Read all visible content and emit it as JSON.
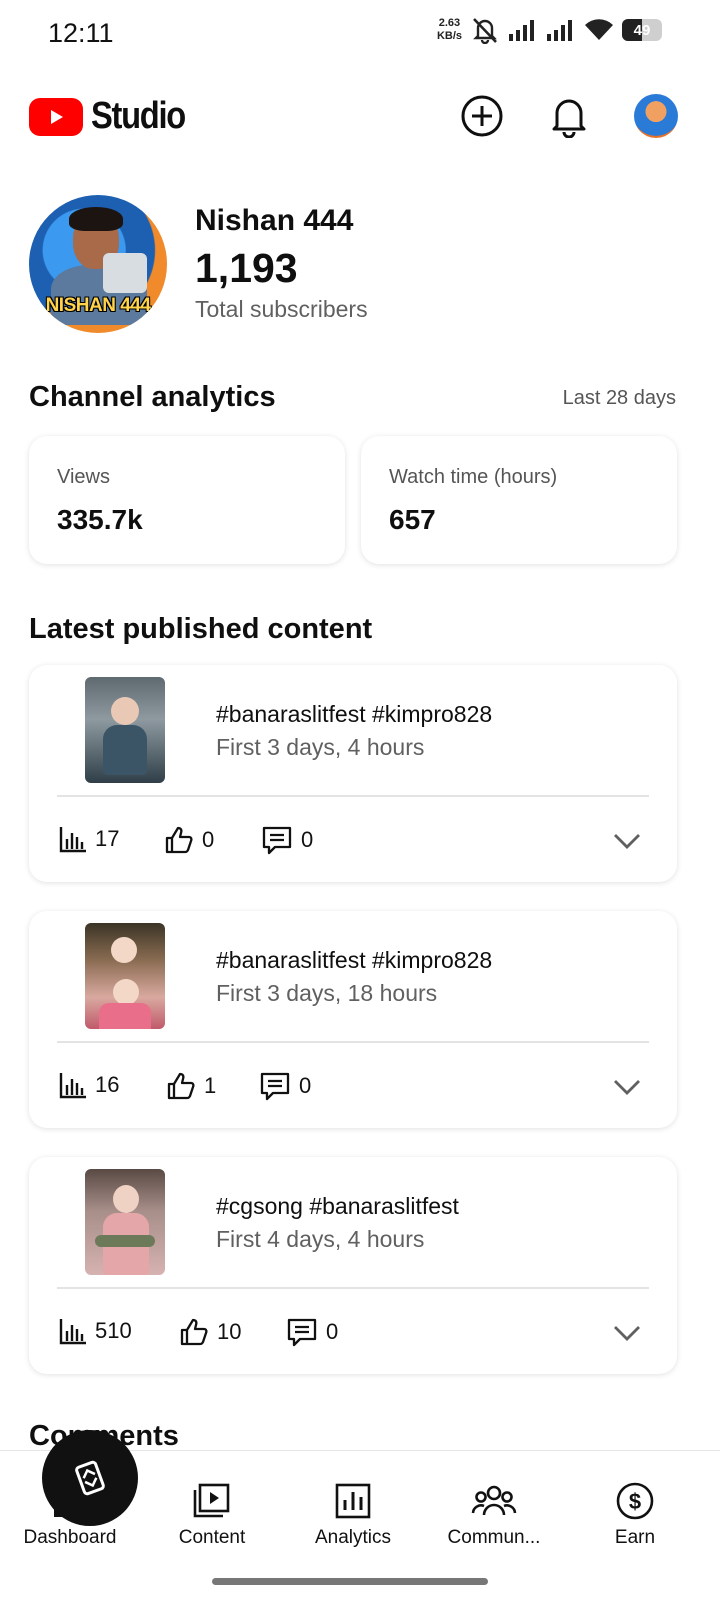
{
  "status_bar": {
    "time": "12:11",
    "net_speed_value": "2.63",
    "net_speed_unit": "KB/s",
    "battery": "49",
    "battery_level_percent": 49
  },
  "header": {
    "brand": "Studio",
    "icons": [
      "youtube-logo-icon",
      "create-plus-icon",
      "bell-icon",
      "account-avatar"
    ]
  },
  "channel": {
    "name": "Nishan 444",
    "subscribers": "1,193",
    "subscribers_label": "Total subscribers",
    "avatar_text": "NISHAN 444"
  },
  "analytics": {
    "title": "Channel analytics",
    "range": "Last 28 days",
    "metrics": [
      {
        "label": "Views",
        "value": "335.7k"
      },
      {
        "label": "Watch time (hours)",
        "value": "657"
      }
    ]
  },
  "latest": {
    "title": "Latest published content",
    "items": [
      {
        "title": "#banaraslitfest #kimpro828",
        "subtitle": "First 3 days, 4 hours",
        "views": "17",
        "likes": "0",
        "comments": "0"
      },
      {
        "title": "#banaraslitfest #kimpro828",
        "subtitle": "First 3 days, 18 hours",
        "views": "16",
        "likes": "1",
        "comments": "0"
      },
      {
        "title": "#cgsong #banaraslitfest",
        "subtitle": "First 4 days, 4 hours",
        "views": "510",
        "likes": "10",
        "comments": "0"
      }
    ]
  },
  "comments_section": {
    "title": "Comments"
  },
  "bottom_nav": {
    "items": [
      {
        "label": "Dashboard",
        "icon": "dashboard-icon"
      },
      {
        "label": "Content",
        "icon": "content-icon"
      },
      {
        "label": "Analytics",
        "icon": "analytics-icon"
      },
      {
        "label": "Commun...",
        "icon": "community-icon"
      },
      {
        "label": "Earn",
        "icon": "earn-icon"
      }
    ],
    "fab_icon": "switch-icon"
  },
  "colors": {
    "brand_red": "#ff0000",
    "text_primary": "#0f0f0f",
    "text_secondary": "#606060"
  }
}
